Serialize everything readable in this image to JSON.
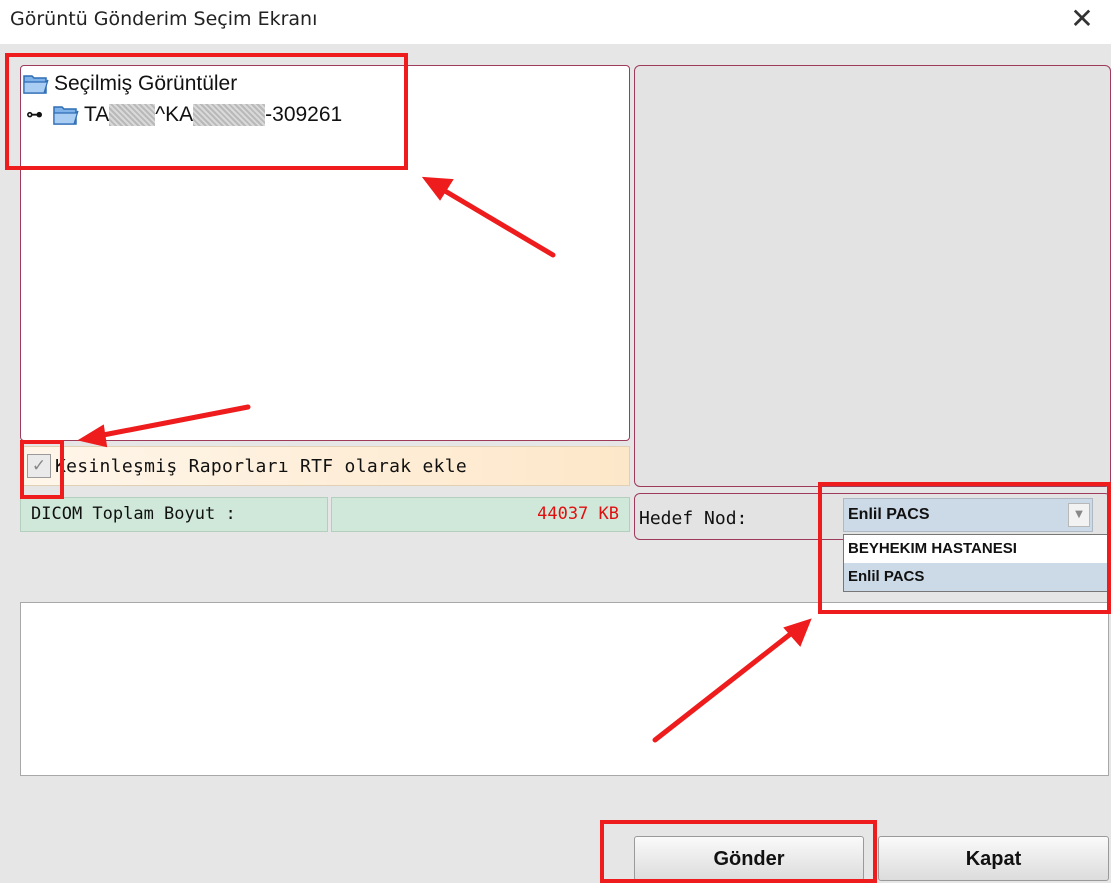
{
  "window": {
    "title": "Görüntü Gönderim Seçim Ekranı",
    "close_glyph": "✕"
  },
  "tree": {
    "root_label": "Seçilmiş Görüntüler",
    "child": {
      "expander_glyph": "⊶",
      "part1": "TA",
      "part2": "^KA",
      "part3": "-309261"
    }
  },
  "options": {
    "rtf_checked": true,
    "rtf_check_glyph": "✓",
    "rtf_label": "Kesinleşmiş Raporları RTF olarak ekle"
  },
  "dicom_size": {
    "label": "DICOM Toplam Boyut :",
    "value": "44037 KB",
    "value_color": "#e01010"
  },
  "target_node": {
    "label": "Hedef Nod:",
    "selected": "Enlil PACS",
    "chevron_glyph": "▼",
    "options": [
      "BEYHEKIM HASTANESI",
      "Enlil PACS"
    ]
  },
  "buttons": {
    "send": "Gönder",
    "close": "Kapat"
  },
  "colors": {
    "annotation": "#ee1c1c",
    "panel_border": "#9e3a5a",
    "size_bar_bg": "#cfe8d9",
    "select_bg": "#ccd9e6"
  }
}
